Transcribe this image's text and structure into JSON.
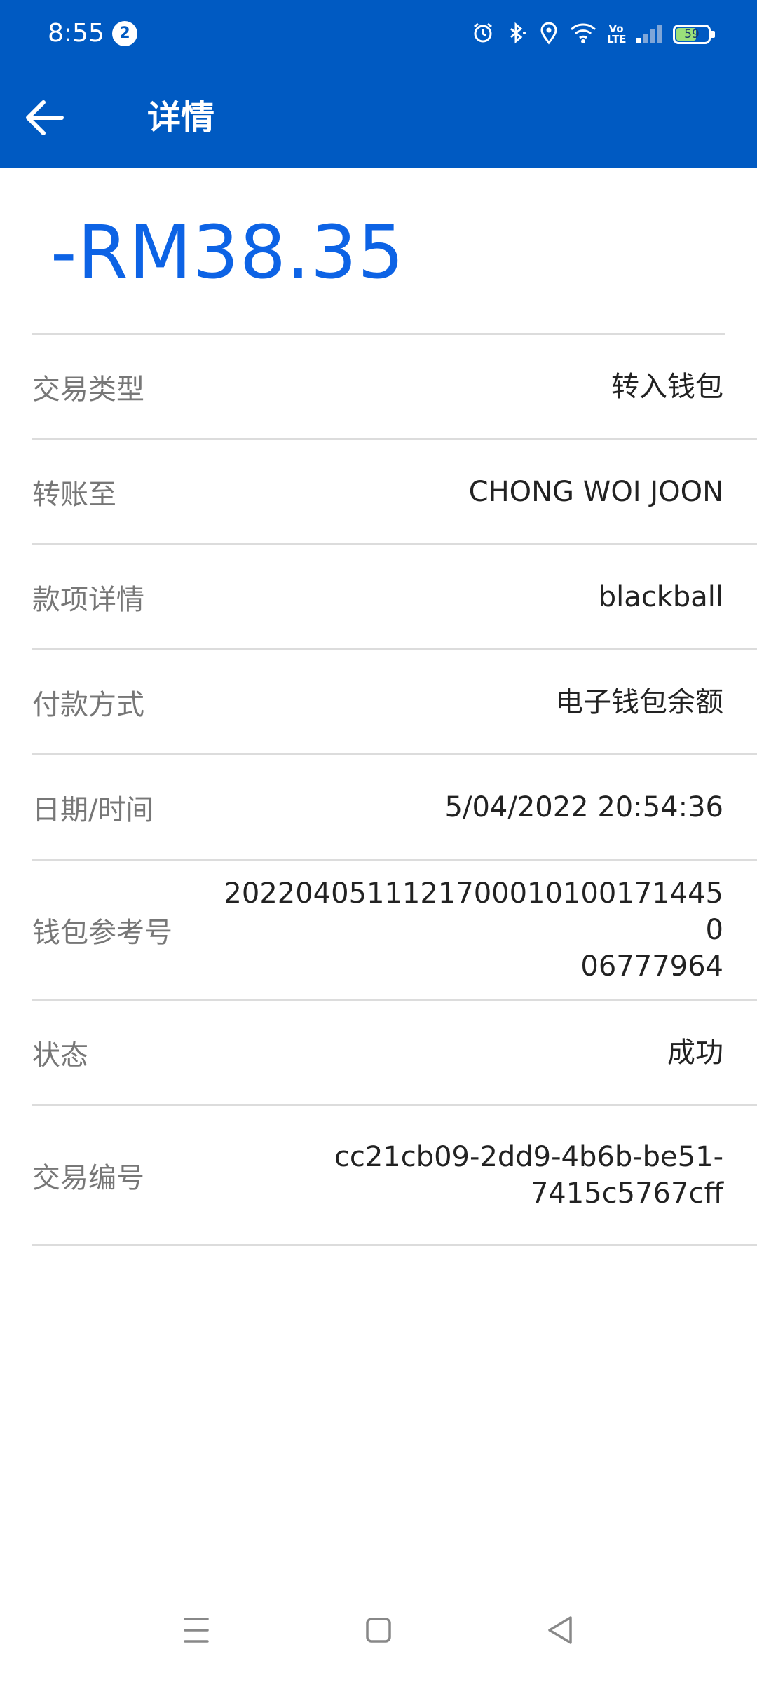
{
  "status_bar": {
    "time": "8:55",
    "notification_count": "2",
    "battery_level": "59",
    "icons": [
      "alarm-icon",
      "bluetooth-icon",
      "location-icon",
      "wifi-icon",
      "volte-icon",
      "signal-icon",
      "battery-icon"
    ],
    "volte_label": "Vo LTE"
  },
  "header": {
    "title": "详情",
    "back_icon": "arrow-left-icon"
  },
  "transaction": {
    "amount": "-RM38.35",
    "rows": [
      {
        "label": "交易类型",
        "value": "转入钱包"
      },
      {
        "label": "转账至",
        "value": "CHONG WOI JOON"
      },
      {
        "label": "款项详情",
        "value": "blackball"
      },
      {
        "label": "付款方式",
        "value": "电子钱包余额"
      },
      {
        "label": "日期/时间",
        "value": "5/04/2022 20:54:36"
      },
      {
        "label": "钱包参考号",
        "value_line1": "20220405111217000101001714450",
        "value_line2": "06777964"
      },
      {
        "label": "状态",
        "value": "成功"
      },
      {
        "label": "交易编号",
        "value_line1": "cc21cb09-2dd9-4b6b-be51-",
        "value_line2": "7415c5767cff"
      }
    ]
  },
  "colors": {
    "primary": "#005ac2",
    "amount": "#0d63e5"
  },
  "nav_bar": {
    "icons": [
      "menu-icon",
      "home-icon",
      "back-triangle-icon"
    ]
  }
}
